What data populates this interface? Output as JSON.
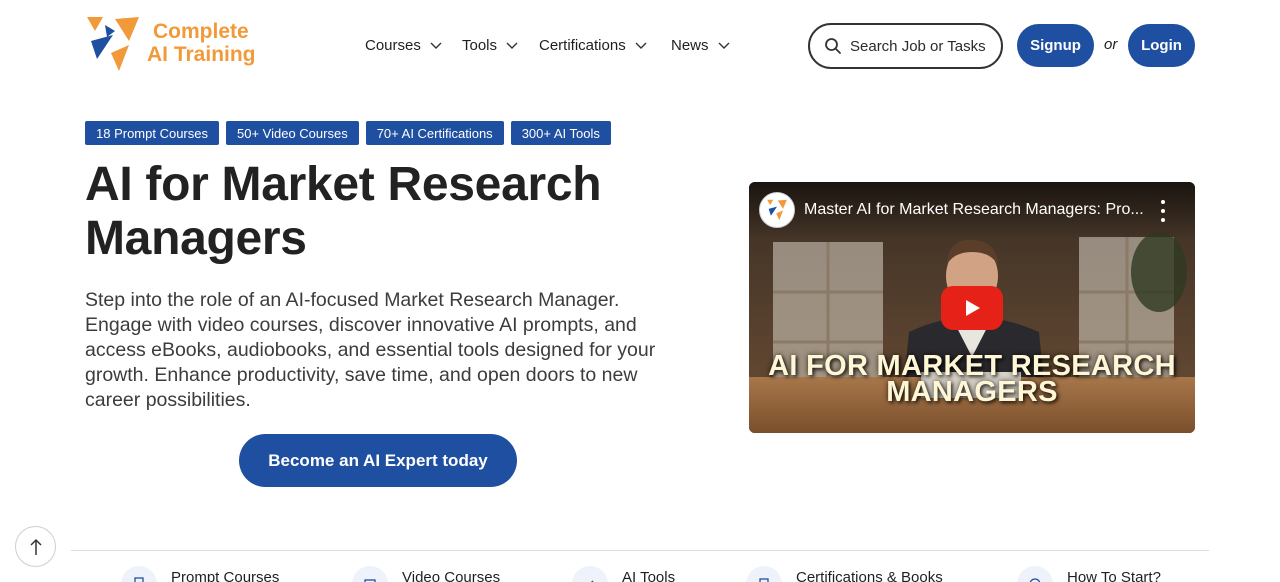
{
  "logo": {
    "line1": "Complete",
    "line2": "AI Training"
  },
  "nav": {
    "items": [
      {
        "label": "Courses"
      },
      {
        "label": "Tools"
      },
      {
        "label": "Certifications"
      },
      {
        "label": "News"
      }
    ]
  },
  "search": {
    "placeholder": "Search Job or Tasks"
  },
  "auth": {
    "signup_label": "Signup",
    "or_label": "or",
    "login_label": "Login"
  },
  "tags": [
    {
      "label": "18 Prompt Courses"
    },
    {
      "label": "50+ Video Courses"
    },
    {
      "label": "70+ AI Certifications"
    },
    {
      "label": "300+ AI Tools"
    }
  ],
  "hero": {
    "title": "AI for Market Research Managers",
    "description": "Step into the role of an AI-focused Market Research Manager. Engage with video courses, discover innovative AI prompts, and access eBooks, audiobooks, and essential tools designed for your growth. Enhance productivity, save time, and open doors to new career possibilities.",
    "cta_label": "Become an AI Expert today"
  },
  "video": {
    "title": "Master AI for Market Research Managers: Pro...",
    "overlay_line1": "AI FOR MARKET RESEARCH",
    "overlay_line2": "MANAGERS"
  },
  "bottom_nav": {
    "items": [
      {
        "label": "Prompt Courses",
        "icon": "document-icon"
      },
      {
        "label": "Video Courses",
        "icon": "video-icon"
      },
      {
        "label": "AI Tools",
        "icon": "wrench-icon"
      },
      {
        "label": "Certifications & Books",
        "icon": "book-icon"
      },
      {
        "label": "How To Start?",
        "icon": "question-icon"
      }
    ]
  },
  "colors": {
    "brand_blue": "#1f4fa0",
    "brand_orange": "#f29a3a"
  }
}
